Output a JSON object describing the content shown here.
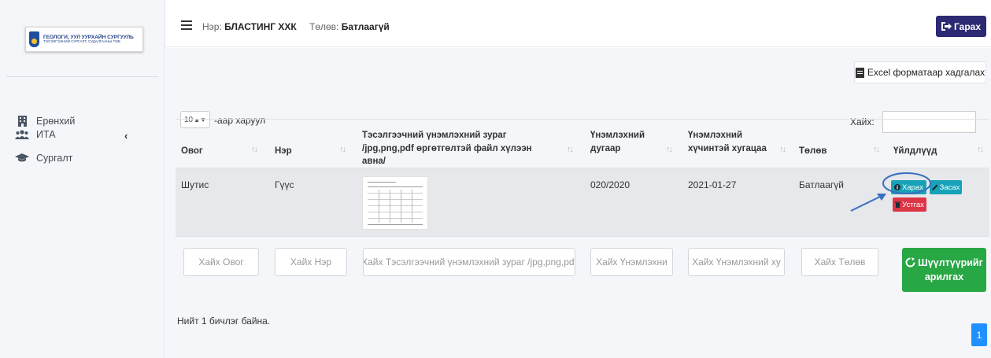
{
  "logo": {
    "line1": "ГЕОЛОГИ, УУЛ УУРХАЙН СУРГУУЛЬ",
    "line2": "ТЭСЭЛГЭЭНИЙ СУРГАЛТ, СУДАЛГААНЫ ТӨВ"
  },
  "sidebar": {
    "items": [
      {
        "label": "Ерөнхий",
        "icon": "building-icon"
      },
      {
        "label": "ИТА",
        "icon": "users-icon"
      },
      {
        "label": "Сургалт",
        "icon": "graduation-cap-icon"
      }
    ]
  },
  "header": {
    "name_label": "Нэр:",
    "name_value": "БЛАСТИНГ ХХК",
    "status_label": "Төлөв:",
    "status_value": "Батлаагүй",
    "logout": "Гарах"
  },
  "toolbar": {
    "excel": "Excel форматаар хадгалах",
    "page_length": "10",
    "page_length_suffix": "-аар харуул",
    "search_label": "Хайх:"
  },
  "table": {
    "columns": [
      "Овог",
      "Нэр",
      "Тэсэлгээчний үнэмлэхний зураг /jpg,png,pdf өргөтгөлтэй файл хүлээн авна/",
      "Үнэмлэхний дугаар",
      "Үнэмлэхний хүчинтэй хугацаа",
      "Төлөв",
      "Үйлдлүүд"
    ],
    "rows": [
      {
        "last_name": "Шутис",
        "first_name": "Гүүс",
        "cert_number": "020/2020",
        "valid_until": "2021-01-27",
        "status": "Батлаагүй"
      }
    ],
    "actions": {
      "view": "Харах",
      "edit": "Засах",
      "delete": "Устгах"
    },
    "filters": [
      "Хайх Овог",
      "Хайх Нэр",
      "Хайх Тэсэлгээчний үнэмлэхний зураг /jpg,png,pdf",
      "Хайх Үнэмлэхни",
      "Хайх Үнэмлэхний ху",
      "Хайх Төлөв"
    ],
    "clear_filters_line1": "Шүүлтүүрийг",
    "clear_filters_line2": "арилгах"
  },
  "footer": {
    "count_text": "Нийт 1 бичлэг байна.",
    "page": "1"
  },
  "colors": {
    "logout_bg": "#2c2a73",
    "info": "#17a2b8",
    "danger": "#dc3545",
    "success": "#28a745",
    "page_active": "#1e90ff",
    "annotation": "#3a6fbf"
  }
}
